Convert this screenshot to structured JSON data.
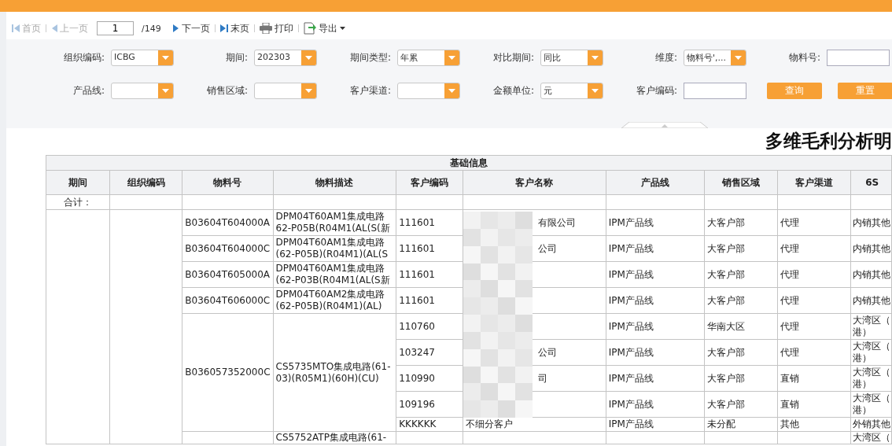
{
  "toolbar": {
    "items": [
      {
        "kind": "first",
        "label": "首页",
        "disabled": true
      },
      {
        "kind": "prev",
        "label": "上一页",
        "disabled": true
      },
      {
        "kind": "page",
        "value": "1",
        "total": "/149"
      },
      {
        "kind": "next",
        "label": "下一页",
        "disabled": false
      },
      {
        "kind": "last",
        "label": "末页",
        "disabled": false
      },
      {
        "kind": "print",
        "label": "打印",
        "disabled": false
      },
      {
        "kind": "export",
        "label": "导出",
        "disabled": false
      }
    ]
  },
  "filters": {
    "rows": [
      [
        {
          "kind": "select",
          "label": "组织编码:",
          "value": "ICBG"
        },
        {
          "kind": "select",
          "label": "期间:",
          "value": "202303"
        },
        {
          "kind": "select",
          "label": "期间类型:",
          "value": "年累"
        },
        {
          "kind": "select",
          "label": "对比期间:",
          "value": "同比"
        },
        {
          "kind": "select",
          "label": "维度:",
          "value": "物料号',..."
        },
        {
          "kind": "input",
          "label": "物料号:"
        }
      ],
      [
        {
          "kind": "select",
          "label": "产品线:"
        },
        {
          "kind": "select",
          "label": "销售区域:"
        },
        {
          "kind": "select",
          "label": "客户渠道:"
        },
        {
          "kind": "select",
          "label": "金额单位:",
          "value": "元"
        },
        {
          "kind": "input",
          "label": "客户编码:"
        },
        {
          "kind": "button",
          "label": "查询"
        },
        {
          "kind": "button",
          "label": "重置"
        }
      ]
    ]
  },
  "report": {
    "title": "多维毛利分析明",
    "group_header": "基础信息",
    "columns": [
      "期间",
      "组织编码",
      "物料号",
      "物料描述",
      "客户编码",
      "客户名称",
      "产品线",
      "销售区域",
      "客户渠道",
      "6S"
    ],
    "total_label": "合计：",
    "groups": [
      {
        "material": "B03604T604000A",
        "description": "DPM04T60AM1集成电路\n62-P05B(R04M1(AL(S(新",
        "customers": [
          {
            "code": "111601",
            "name": "有限公司",
            "product_line": "IPM产品线",
            "region": "大客户部",
            "channel": "代理",
            "six_s": "内销其他"
          }
        ]
      },
      {
        "material": "B03604T604000C",
        "description": "DPM04T60AM1集成电路\n(62-P05B)(R04M1)(AL(S",
        "customers": [
          {
            "code": "111601",
            "name": "公司",
            "product_line": "IPM产品线",
            "region": "大客户部",
            "channel": "代理",
            "six_s": "内销其他"
          }
        ]
      },
      {
        "material": "B03604T605000A",
        "description": "DPM04T60AM1集成电路\n(62-P03B(R04M1(AL(S新",
        "customers": [
          {
            "code": "111601",
            "product_line": "IPM产品线",
            "region": "大客户部",
            "channel": "代理",
            "six_s": "内销其他"
          }
        ]
      },
      {
        "material": "B03604T606000C",
        "description": "DPM04T60AM2集成电路\n(62-P05B)(R04M1)(AL)",
        "customers": [
          {
            "code": "111601",
            "product_line": "IPM产品线",
            "region": "大客户部",
            "channel": "代理",
            "six_s": "内销其他"
          }
        ]
      },
      {
        "material": "B036057352000C",
        "description": "CS5735MTO集成电路(61-\n03)(R05M1)(60H)(CU)",
        "customers": [
          {
            "code": "110760",
            "product_line": "IPM产品线",
            "region": "华南大区",
            "channel": "代理",
            "six_s": "大湾区（港）"
          },
          {
            "code": "103247",
            "name": "公司",
            "product_line": "IPM产品线",
            "region": "大客户部",
            "channel": "代理",
            "six_s": "大湾区（港）"
          },
          {
            "code": "110990",
            "name": "司",
            "product_line": "IPM产品线",
            "region": "大客户部",
            "channel": "直销",
            "six_s": "大湾区（港）"
          },
          {
            "code": "109196",
            "product_line": "IPM产品线",
            "region": "大客户部",
            "channel": "直销",
            "six_s": "大湾区（港）"
          },
          {
            "code": "KKKKKK",
            "name": "不细分客户",
            "product_line": "IPM产品线",
            "region": "未分配",
            "channel": "其他",
            "six_s": "外销其他"
          }
        ]
      },
      {
        "description": "CS5752ATP集成电路(61-",
        "customers": [
          {
            "six_s": "大湾区（"
          }
        ]
      }
    ]
  }
}
